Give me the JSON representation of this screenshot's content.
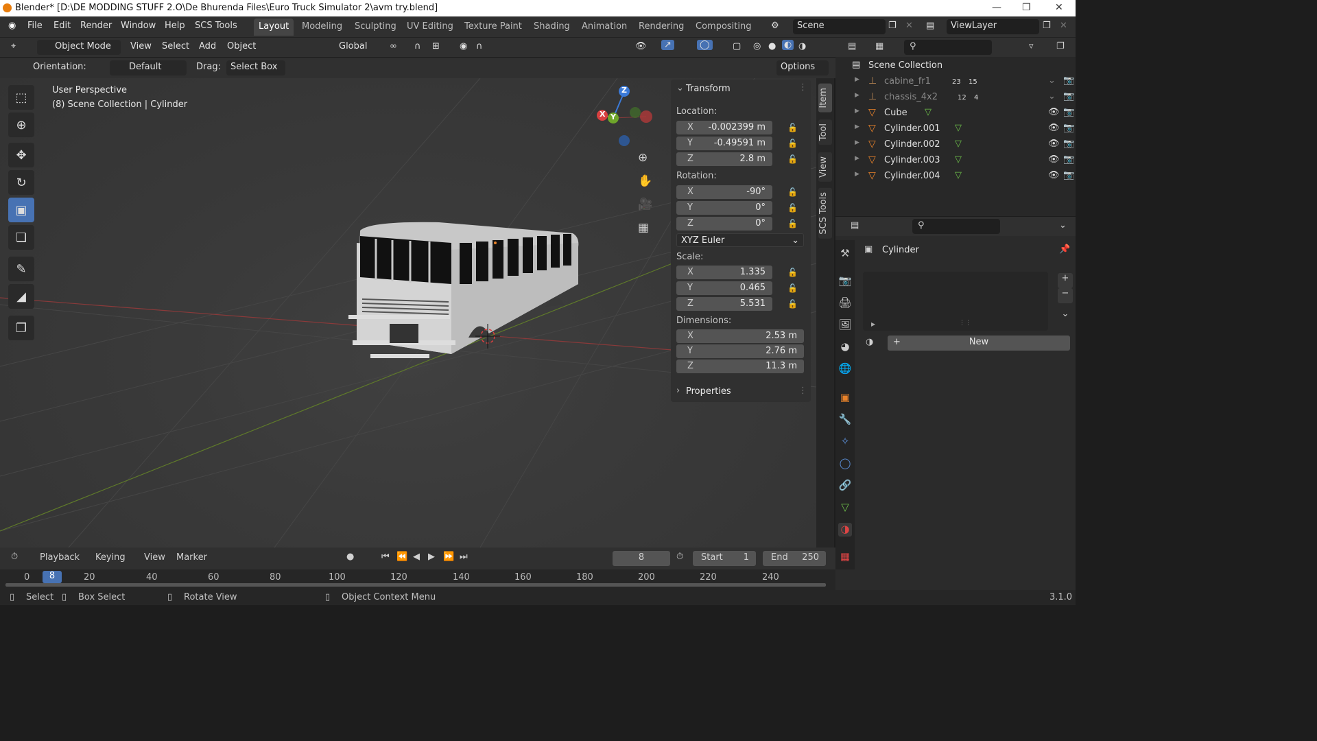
{
  "titlebar": {
    "title": "Blender* [D:\\DE MODDING STUFF 2.O\\De Bhurenda Files\\Euro Truck Simulator 2\\avm try.blend]"
  },
  "menu": [
    "File",
    "Edit",
    "Render",
    "Window",
    "Help",
    "SCS Tools"
  ],
  "workspaces": [
    "Layout",
    "Modeling",
    "Sculpting",
    "UV Editing",
    "Texture Paint",
    "Shading",
    "Animation",
    "Rendering",
    "Compositing"
  ],
  "scene": {
    "name": "Scene",
    "viewlayer": "ViewLayer"
  },
  "header": {
    "mode": "Object Mode",
    "menus": [
      "View",
      "Select",
      "Add",
      "Object"
    ],
    "transform_orientation": "Global"
  },
  "toolsettings": {
    "orientation_label": "Orientation:",
    "orientation": "Default",
    "drag_label": "Drag:",
    "drag": "Select Box",
    "options": "Options"
  },
  "viewport": {
    "perspective": "User Perspective",
    "collection": "(8) Scene Collection | Cylinder"
  },
  "gizmo": {
    "x": "X",
    "y": "Y",
    "z": "Z"
  },
  "transform": {
    "title": "Transform",
    "location_label": "Location:",
    "location": {
      "x": "-0.002399 m",
      "y": "-0.49591 m",
      "z": "2.8 m"
    },
    "rotation_label": "Rotation:",
    "rotation": {
      "x": "-90°",
      "y": "0°",
      "z": "0°"
    },
    "rotation_mode": "XYZ Euler",
    "scale_label": "Scale:",
    "scale": {
      "x": "1.335",
      "y": "0.465",
      "z": "5.531"
    },
    "dimensions_label": "Dimensions:",
    "dimensions": {
      "x": "2.53 m",
      "y": "2.76 m",
      "z": "11.3 m"
    },
    "properties": "Properties"
  },
  "sidetabs": [
    "Item",
    "Tool",
    "View",
    "SCS Tools"
  ],
  "outliner": {
    "root": "Scene Collection",
    "items": [
      {
        "name": "cabine_fr1",
        "badge1": "23",
        "badge2": "15"
      },
      {
        "name": "chassis_4x2",
        "badge1": "12",
        "badge2": "4"
      },
      {
        "name": "Cube"
      },
      {
        "name": "Cylinder.001"
      },
      {
        "name": "Cylinder.002"
      },
      {
        "name": "Cylinder.003"
      },
      {
        "name": "Cylinder.004"
      }
    ]
  },
  "properties": {
    "object": "Cylinder",
    "new_button": "New"
  },
  "timeline": {
    "menus": [
      "Playback",
      "Keying",
      "View",
      "Marker"
    ],
    "current_frame": "8",
    "start_label": "Start",
    "start": "1",
    "end_label": "End",
    "end": "250",
    "ticks": [
      "0",
      "20",
      "40",
      "60",
      "80",
      "100",
      "120",
      "140",
      "160",
      "180",
      "200",
      "220",
      "240"
    ],
    "playhead": "8"
  },
  "statusbar": {
    "select": "Select",
    "box_select": "Box Select",
    "rotate_view": "Rotate View",
    "context_menu": "Object Context Menu",
    "version": "3.1.0"
  }
}
